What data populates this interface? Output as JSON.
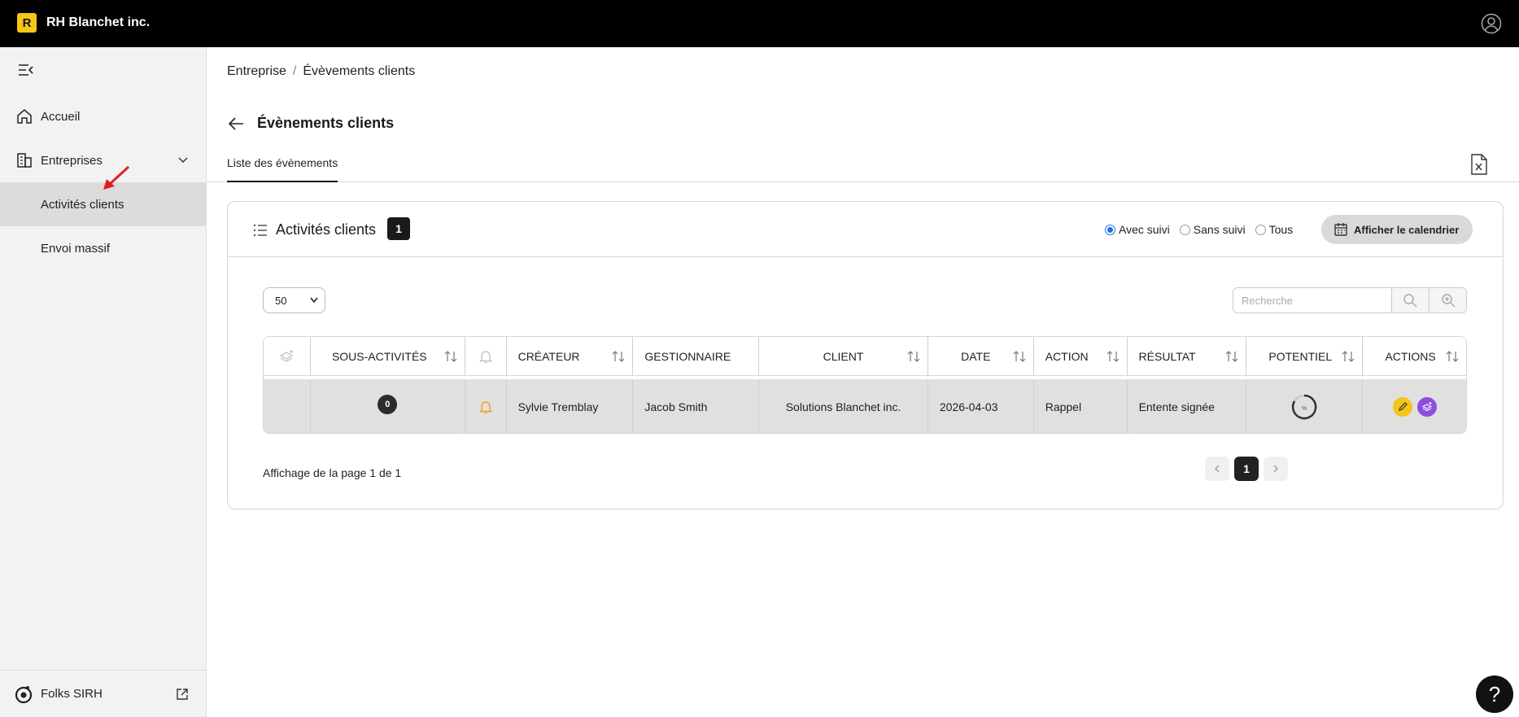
{
  "app": {
    "logo_letter": "R",
    "company": "RH Blanchet inc.",
    "brand_color": "#F5C518"
  },
  "sidebar": {
    "items": [
      {
        "label": "Accueil",
        "icon": "home-icon"
      },
      {
        "label": "Entreprises",
        "icon": "buildings-icon"
      },
      {
        "label": "Activités clients",
        "active": true
      },
      {
        "label": "Envoi massif"
      }
    ],
    "footer": {
      "label": "Folks SIRH",
      "icon": "folks-logo-icon"
    }
  },
  "breadcrumb": {
    "root": "Entreprise",
    "separator": "/",
    "current": "Évèvements clients"
  },
  "page": {
    "title": "Évènements clients",
    "tab": "Liste des évènements"
  },
  "card": {
    "title": "Activités clients",
    "count": "1",
    "filters": [
      {
        "label": "Avec suivi",
        "selected": true
      },
      {
        "label": "Sans suivi",
        "selected": false
      },
      {
        "label": "Tous",
        "selected": false
      }
    ],
    "calendar_button": "Afficher le calendrier",
    "page_size": "50",
    "search_placeholder": "Recherche"
  },
  "table": {
    "columns": [
      "SOUS-ACTIVITÉS",
      "CRÉATEUR",
      "GESTIONNAIRE",
      "CLIENT",
      "DATE",
      "ACTION",
      "RÉSULTAT",
      "POTENTIEL",
      "ACTIONS"
    ],
    "rows": [
      {
        "sub_activities": "0",
        "creator": "Sylvie Tremblay",
        "manager": "Jacob Smith",
        "client": "Solutions Blanchet inc.",
        "date": "2026-04-03",
        "action": "Rappel",
        "result": "Entente signée",
        "potential_label": "%"
      }
    ]
  },
  "pagination": {
    "text": "Affichage de la page 1 de 1",
    "current": "1"
  },
  "help": {
    "label": "?"
  }
}
